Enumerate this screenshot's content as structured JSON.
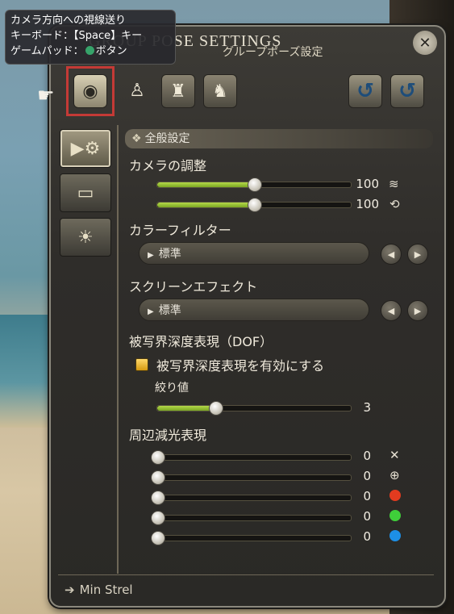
{
  "tooltip": {
    "line1": "カメラ方向への視線送り",
    "line2": "キーボード：【Space】キー",
    "line3_prefix": "ゲームパッド：",
    "line3_suffix": "ボタン"
  },
  "window": {
    "title": "GROUP POSE SETTINGS",
    "subtitle": "グループポーズ設定"
  },
  "section": {
    "header": "全般設定"
  },
  "camera": {
    "label": "カメラの調整",
    "slider1": {
      "value": "100",
      "fraction": 0.5
    },
    "slider2": {
      "value": "100",
      "fraction": 0.5
    }
  },
  "color_filter": {
    "label": "カラーフィルター",
    "value": "標準"
  },
  "screen_effect": {
    "label": "スクリーンエフェクト",
    "value": "標準"
  },
  "dof": {
    "label": "被写界深度表現（DOF）",
    "enable_label": "被写界深度表現を有効にする",
    "aperture_label": "絞り値",
    "aperture": {
      "value": "3",
      "fraction": 0.3
    }
  },
  "vignette": {
    "label": "周辺減光表現",
    "rows": [
      {
        "value": "0",
        "fraction": 0
      },
      {
        "value": "0",
        "fraction": 0
      },
      {
        "value": "0",
        "fraction": 0
      },
      {
        "value": "0",
        "fraction": 0
      },
      {
        "value": "0",
        "fraction": 0
      }
    ]
  },
  "colors": {
    "red": "#e23b1f",
    "green": "#3fcf3a",
    "blue": "#1d8fe6",
    "accent": "#b5d84a"
  },
  "footer": {
    "character": "Min Strel"
  }
}
